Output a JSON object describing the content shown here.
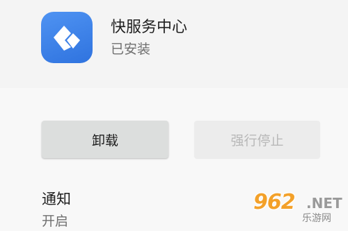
{
  "app": {
    "name": "快服务中心",
    "status": "已安装",
    "icon": "kuai-service-logo-icon",
    "icon_color": "#3f85ea"
  },
  "actions": {
    "uninstall_label": "卸载",
    "force_stop_label": "强行停止"
  },
  "notification": {
    "title": "通知",
    "value": "开启"
  },
  "watermark": {
    "number": "962",
    "domain": ".NET",
    "label": "乐游网",
    "color": "#f3a12a"
  }
}
